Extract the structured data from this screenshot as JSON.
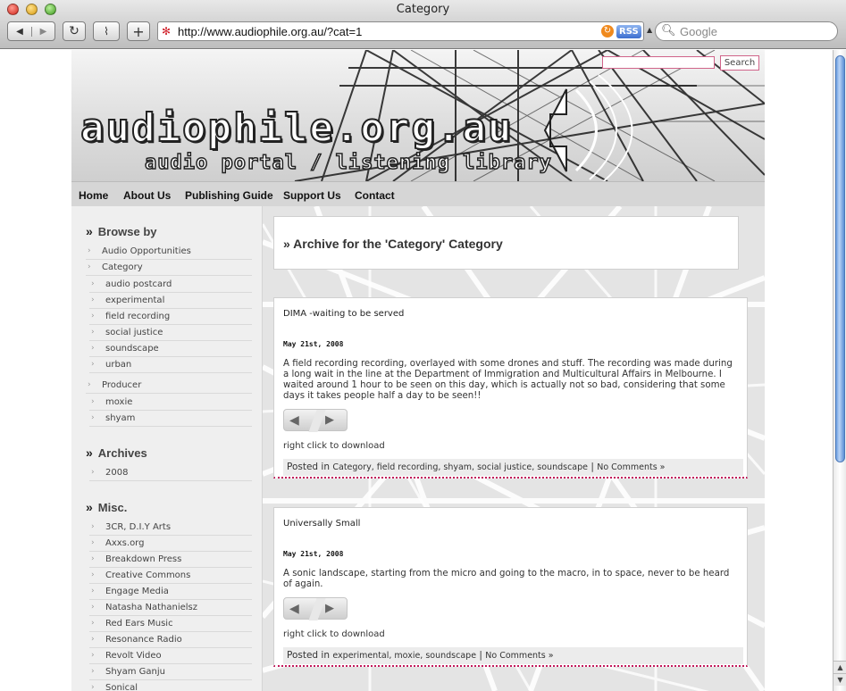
{
  "window": {
    "title": "Category"
  },
  "toolbar": {
    "back_icon": "back-arrow-icon",
    "forward_icon": "forward-arrow-icon",
    "url": "http://www.audiophile.org.au/?cat=1",
    "rss_label": "RSS",
    "search_placeholder": "Google"
  },
  "site": {
    "title": "audiophile.org.au",
    "tagline": "audio portal / listening library",
    "search_button": "Search"
  },
  "nav": [
    "Home",
    "About Us",
    "Publishing Guide",
    "Support Us",
    "Contact"
  ],
  "sidebar": {
    "browse_heading": "Browse by",
    "browse_items": [
      "Audio Opportunities",
      "Category"
    ],
    "category_items": [
      "audio postcard",
      "experimental",
      "field recording",
      "social justice",
      "soundscape",
      "urban"
    ],
    "producer_label": "Producer",
    "producer_items": [
      "moxie",
      "shyam"
    ],
    "archives_heading": "Archives",
    "archive_items": [
      "2008"
    ],
    "misc_heading": "Misc.",
    "misc_items": [
      "3CR, D.I.Y Arts",
      "Axxs.org",
      "Breakdown Press",
      "Creative Commons",
      "Engage Media",
      "Natasha Nathanielsz",
      "Red Ears Music",
      "Resonance Radio",
      "Revolt Video",
      "Shyam Ganju",
      "Sonical"
    ]
  },
  "main": {
    "archive_title": "Archive for the 'Category' Category",
    "posts": [
      {
        "title": "DIMA -waiting to be served",
        "date": "May 21st, 2008",
        "body": "A field recording recording, overlayed with some drones and stuff. The recording was made during a long wait in the line at the Department of Immigration and Multicultural Affairs in Melbourne. I waited around 1 hour to be seen on this day, which is actually not so bad, considering that some days it takes people half a day to be seen!!",
        "download": "right click to download",
        "posted_in": "Posted in",
        "categories": "Category, field recording, shyam, social justice, soundscape",
        "separator": "|",
        "comments": "No Comments »"
      },
      {
        "title": "Universally Small",
        "date": "May 21st, 2008",
        "body": "A sonic landscape, starting from the micro and going to the macro, in to space, never to be heard of again.",
        "download": "right click to download",
        "posted_in": "Posted in",
        "categories": "experimental, moxie, soundscape",
        "separator": "|",
        "comments": "No Comments »"
      }
    ]
  }
}
